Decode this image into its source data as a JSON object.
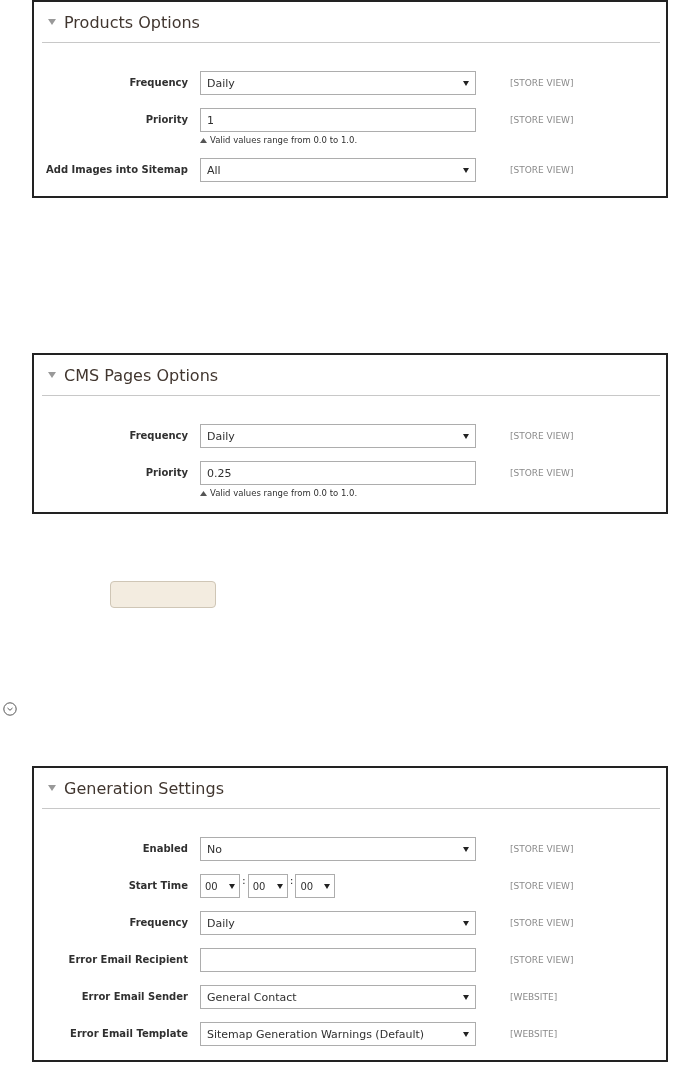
{
  "sections": [
    {
      "kind": "panel",
      "title": "Products Options",
      "expanded": true,
      "rows": [
        {
          "kind": "select",
          "label": "Frequency",
          "value": "Daily",
          "scope": "[STORE VIEW]"
        },
        {
          "kind": "input",
          "label": "Priority",
          "value": "1",
          "hint": "Valid values range from 0.0 to 1.0.",
          "scope": "[STORE VIEW]"
        },
        {
          "kind": "select",
          "label": "Add Images into Sitemap",
          "value": "All",
          "scope": "[STORE VIEW]"
        }
      ]
    },
    {
      "kind": "panel",
      "title": "CMS Pages Options",
      "expanded": true,
      "rows": [
        {
          "kind": "select",
          "label": "Frequency",
          "value": "Daily",
          "scope": "[STORE VIEW]"
        },
        {
          "kind": "input",
          "label": "Priority",
          "value": "0.25",
          "hint": "Valid values range from 0.0 to 1.0.",
          "scope": "[STORE VIEW]"
        }
      ]
    },
    {
      "kind": "button"
    },
    {
      "kind": "toggle"
    },
    {
      "kind": "panel",
      "title": "Generation Settings",
      "expanded": true,
      "rows": [
        {
          "kind": "select",
          "label": "Enabled",
          "value": "No",
          "scope": "[STORE VIEW]"
        },
        {
          "kind": "time",
          "label": "Start Time",
          "parts": [
            "00",
            "00",
            "00"
          ],
          "separators": [
            ":",
            ":"
          ],
          "scope": "[STORE VIEW]"
        },
        {
          "kind": "select",
          "label": "Frequency",
          "value": "Daily",
          "scope": "[STORE VIEW]"
        },
        {
          "kind": "input",
          "label": "Error Email Recipient",
          "value": "",
          "scope": "[STORE VIEW]"
        },
        {
          "kind": "select",
          "label": "Error Email Sender",
          "value": "General Contact",
          "scope": "[WEBSITE]"
        },
        {
          "kind": "select",
          "label": "Error Email Template",
          "value": "Sitemap Generation Warnings (Default)",
          "scope": "[WEBSITE]"
        }
      ]
    }
  ]
}
